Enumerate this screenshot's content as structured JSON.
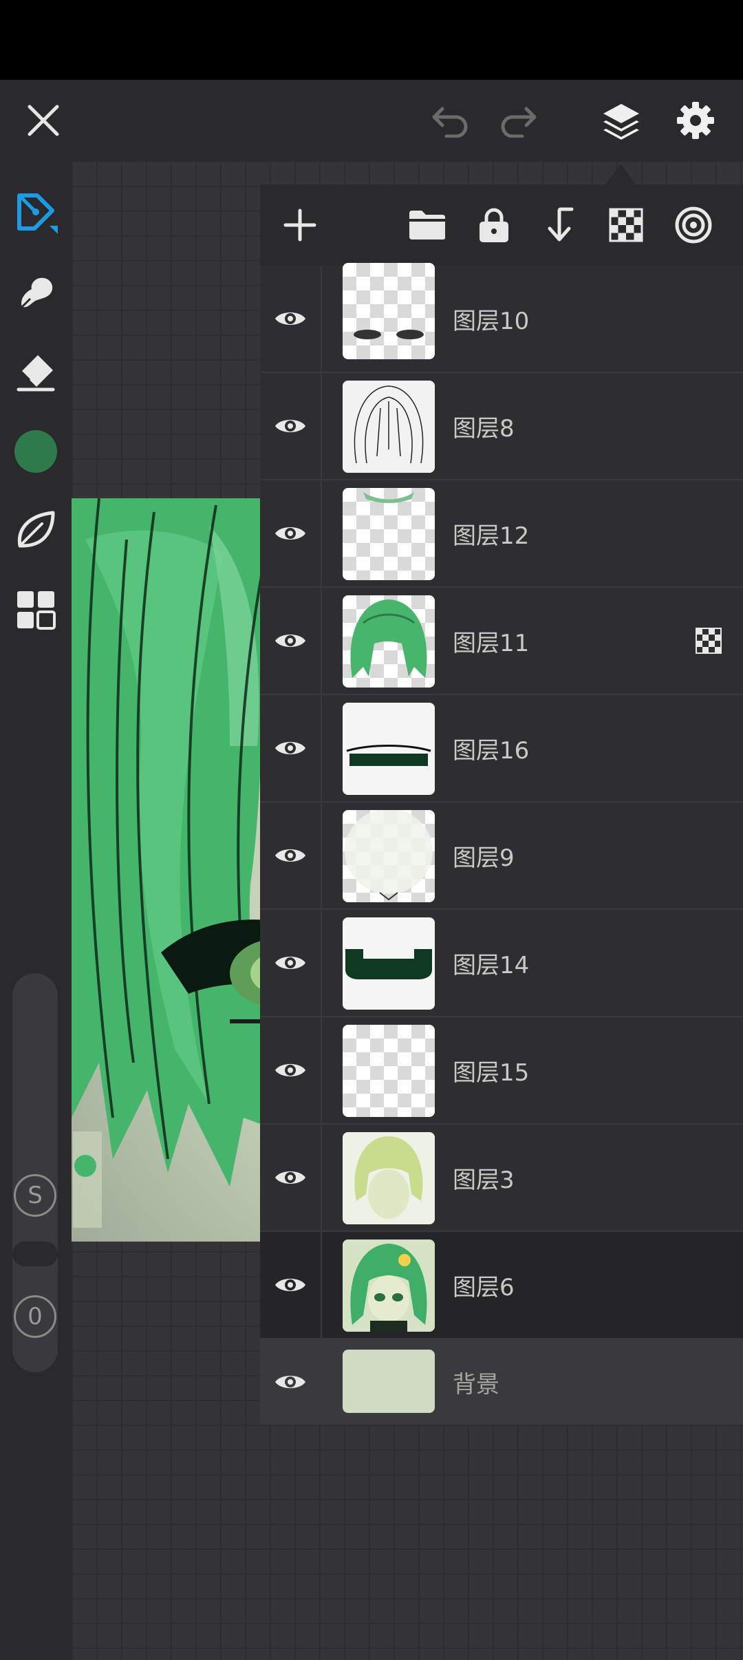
{
  "colors": {
    "accent": "#1e9be6",
    "current_color": "#2f7a4a",
    "hair_green": "#3fae66",
    "background_layer": "#d2dcc4"
  },
  "topbar": {
    "close_icon": "close-icon",
    "undo_icon": "undo-icon",
    "redo_icon": "redo-icon",
    "layers_icon": "layers-icon",
    "settings_icon": "gear-icon"
  },
  "toolbar": {
    "tools": [
      "pen-icon",
      "smudge-icon",
      "eraser-icon",
      "color-swatch",
      "leaf-brush-icon",
      "grid-tools-icon"
    ],
    "size_label": "S",
    "opacity_label": "0"
  },
  "layer_panel": {
    "actions": [
      "add-layer-icon",
      "folder-icon",
      "lock-icon",
      "merge-down-icon",
      "transparency-icon",
      "blend-icon"
    ],
    "layers": [
      {
        "name": "图层10",
        "visible": true,
        "alpha_lock": false,
        "selected": false
      },
      {
        "name": "图层8",
        "visible": true,
        "alpha_lock": false,
        "selected": false
      },
      {
        "name": "图层12",
        "visible": true,
        "alpha_lock": false,
        "selected": false
      },
      {
        "name": "图层11",
        "visible": true,
        "alpha_lock": true,
        "selected": false
      },
      {
        "name": "图层16",
        "visible": true,
        "alpha_lock": false,
        "selected": false
      },
      {
        "name": "图层9",
        "visible": true,
        "alpha_lock": false,
        "selected": false
      },
      {
        "name": "图层14",
        "visible": true,
        "alpha_lock": false,
        "selected": false
      },
      {
        "name": "图层15",
        "visible": true,
        "alpha_lock": false,
        "selected": false
      },
      {
        "name": "图层3",
        "visible": true,
        "alpha_lock": false,
        "selected": false
      },
      {
        "name": "图层6",
        "visible": true,
        "alpha_lock": false,
        "selected": true
      }
    ],
    "background": {
      "name": "背景",
      "visible": true
    }
  }
}
